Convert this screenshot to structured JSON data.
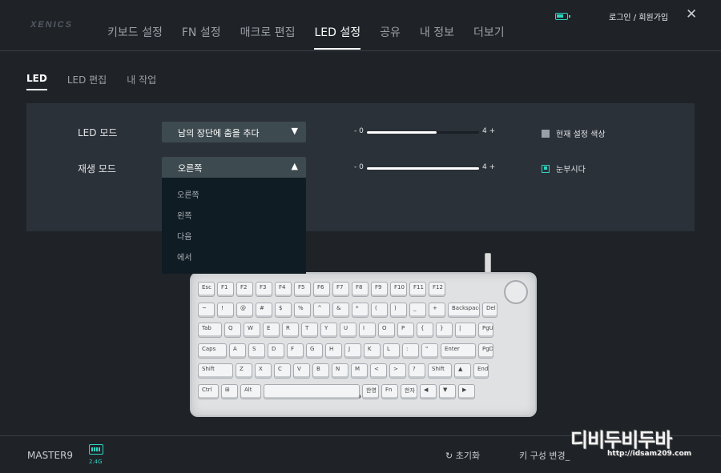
{
  "header": {
    "logo": "XENICS",
    "nav": [
      "키보드 설정",
      "FN 설정",
      "매크로 편집",
      "LED 설정",
      "공유",
      "내 정보",
      "더보기"
    ],
    "active_nav": "LED 설정",
    "login": "로그인 / 회원가입",
    "close_icon": "close-icon",
    "battery_icon": "battery-icon"
  },
  "subtabs": {
    "items": [
      "LED",
      "LED 편집",
      "내 작업"
    ],
    "active": "LED"
  },
  "panel": {
    "led_mode_label": "LED 모드",
    "led_mode_value": "남의 장단에 춤을 추다",
    "play_mode_label": "재생 모드",
    "play_mode_value": "오른쪽",
    "play_mode_options": [
      "오른쪽",
      "왼쪽",
      "다음",
      "에서"
    ],
    "slider1": {
      "min_label": "- 0",
      "max_label": "4 +",
      "level": 0.62
    },
    "slider2": {
      "min_label": "- 0",
      "max_label": "4 +",
      "level": 1.0
    },
    "current_color_label": "현재 설정 색상",
    "current_color_checked": false,
    "dazzle_label": "눈부시다",
    "dazzle_checked": true
  },
  "keyboard": {
    "brand": "MASTER-9",
    "rows": [
      [
        "Esc",
        "F1",
        "F2",
        "F3",
        "F4",
        "F5",
        "F6",
        "F7",
        "F8",
        "F9",
        "F10",
        "F11",
        "F12"
      ],
      [
        "~",
        "!",
        "@",
        "#",
        "$",
        "%",
        "^",
        "&",
        "*",
        "(",
        ")",
        "_",
        "+",
        "Backspace",
        "Del"
      ],
      [
        "Tab",
        "Q",
        "W",
        "E",
        "R",
        "T",
        "Y",
        "U",
        "I",
        "O",
        "P",
        "{",
        "}",
        "|",
        "PgUp"
      ],
      [
        "Caps",
        "A",
        "S",
        "D",
        "F",
        "G",
        "H",
        "J",
        "K",
        "L",
        ":",
        "\"",
        "Enter",
        "PgDn"
      ],
      [
        "Shift",
        "Z",
        "X",
        "C",
        "V",
        "B",
        "N",
        "M",
        "<",
        ">",
        "?",
        "Shift",
        "▲",
        "End"
      ],
      [
        "Ctrl",
        "⊞",
        "Alt",
        "",
        "한영",
        "Fn",
        "한자",
        "◀",
        "▼",
        "▶"
      ]
    ]
  },
  "footer": {
    "device": "MASTER9",
    "connection": "2.4G",
    "reset": "초기화",
    "keyconfig": "키 구성 변경_"
  },
  "watermark": {
    "text": "디비두비두바",
    "url": "http://idsam209.com"
  },
  "colors": {
    "accent": "#2fd3c2",
    "background": "#1f2328",
    "panel": "#2b3138"
  }
}
